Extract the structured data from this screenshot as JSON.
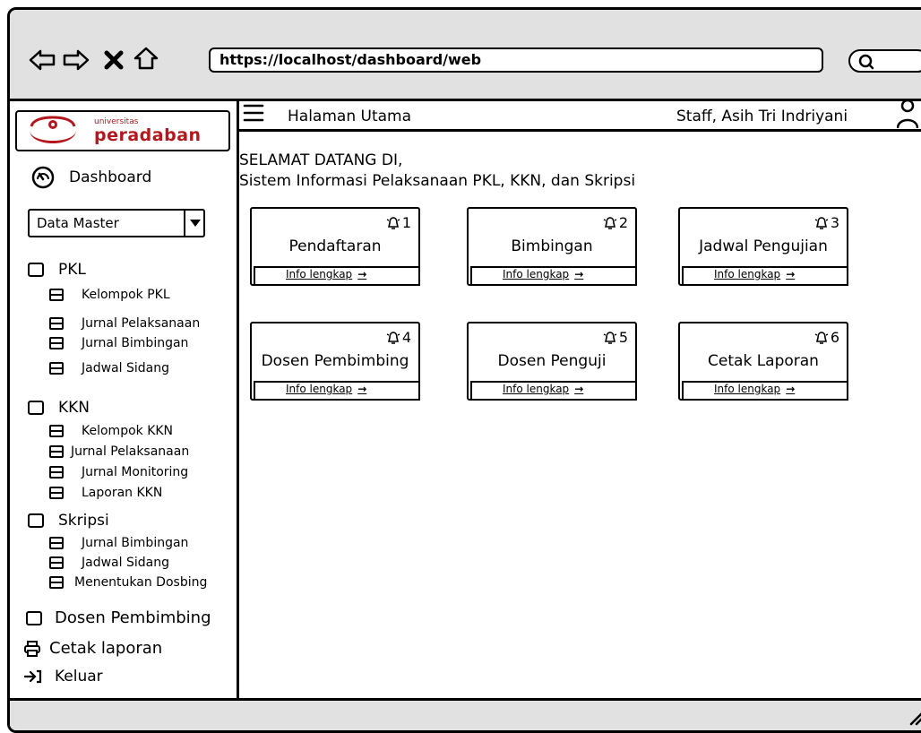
{
  "browser": {
    "url": "https://localhost/dashboard/web"
  },
  "logo": {
    "small_text": "universitas",
    "brand_text": "peradaban"
  },
  "header": {
    "title": "Halaman Utama",
    "user": "Staff, Asih Tri Indriyani"
  },
  "welcome": {
    "line1": "SELAMAT DATANG DI,",
    "line2": "Sistem Informasi Pelaksanaan PKL, KKN, dan Skripsi"
  },
  "sidebar": {
    "dashboard_label": "Dashboard",
    "dropdown_value": "Data Master",
    "pkl": {
      "label": "PKL",
      "items": [
        "Kelompok PKL",
        "Jurnal Pelaksanaan",
        "Jurnal Bimbingan",
        "Jadwal Sidang"
      ]
    },
    "kkn": {
      "label": "KKN",
      "items": [
        "Kelompok KKN",
        "Jurnal Pelaksanaan",
        "Jurnal Monitoring",
        "Laporan KKN"
      ]
    },
    "skripsi": {
      "label": "Skripsi",
      "items": [
        "Jurnal Bimbingan",
        "Jadwal Sidang",
        "Menentukan Dosbing"
      ]
    },
    "dosen_label": "Dosen Pembimbing",
    "cetak_label": "Cetak laporan",
    "keluar_label": "Keluar"
  },
  "cards": [
    {
      "title": "Pendaftaran",
      "count": "1",
      "info": "Info lengkap"
    },
    {
      "title": "Bimbingan",
      "count": "2",
      "info": "Info lengkap"
    },
    {
      "title": "Jadwal Pengujian",
      "count": "3",
      "info": "Info lengkap"
    },
    {
      "title": "Dosen Pembimbing",
      "count": "4",
      "info": "Info lengkap"
    },
    {
      "title": "Dosen Penguji",
      "count": "5",
      "info": "Info lengkap"
    },
    {
      "title": "Cetak Laporan",
      "count": "6",
      "info": "Info lengkap"
    }
  ],
  "colors": {
    "brand_red": "#b5171f",
    "chrome_gray": "#e1e1e1"
  }
}
